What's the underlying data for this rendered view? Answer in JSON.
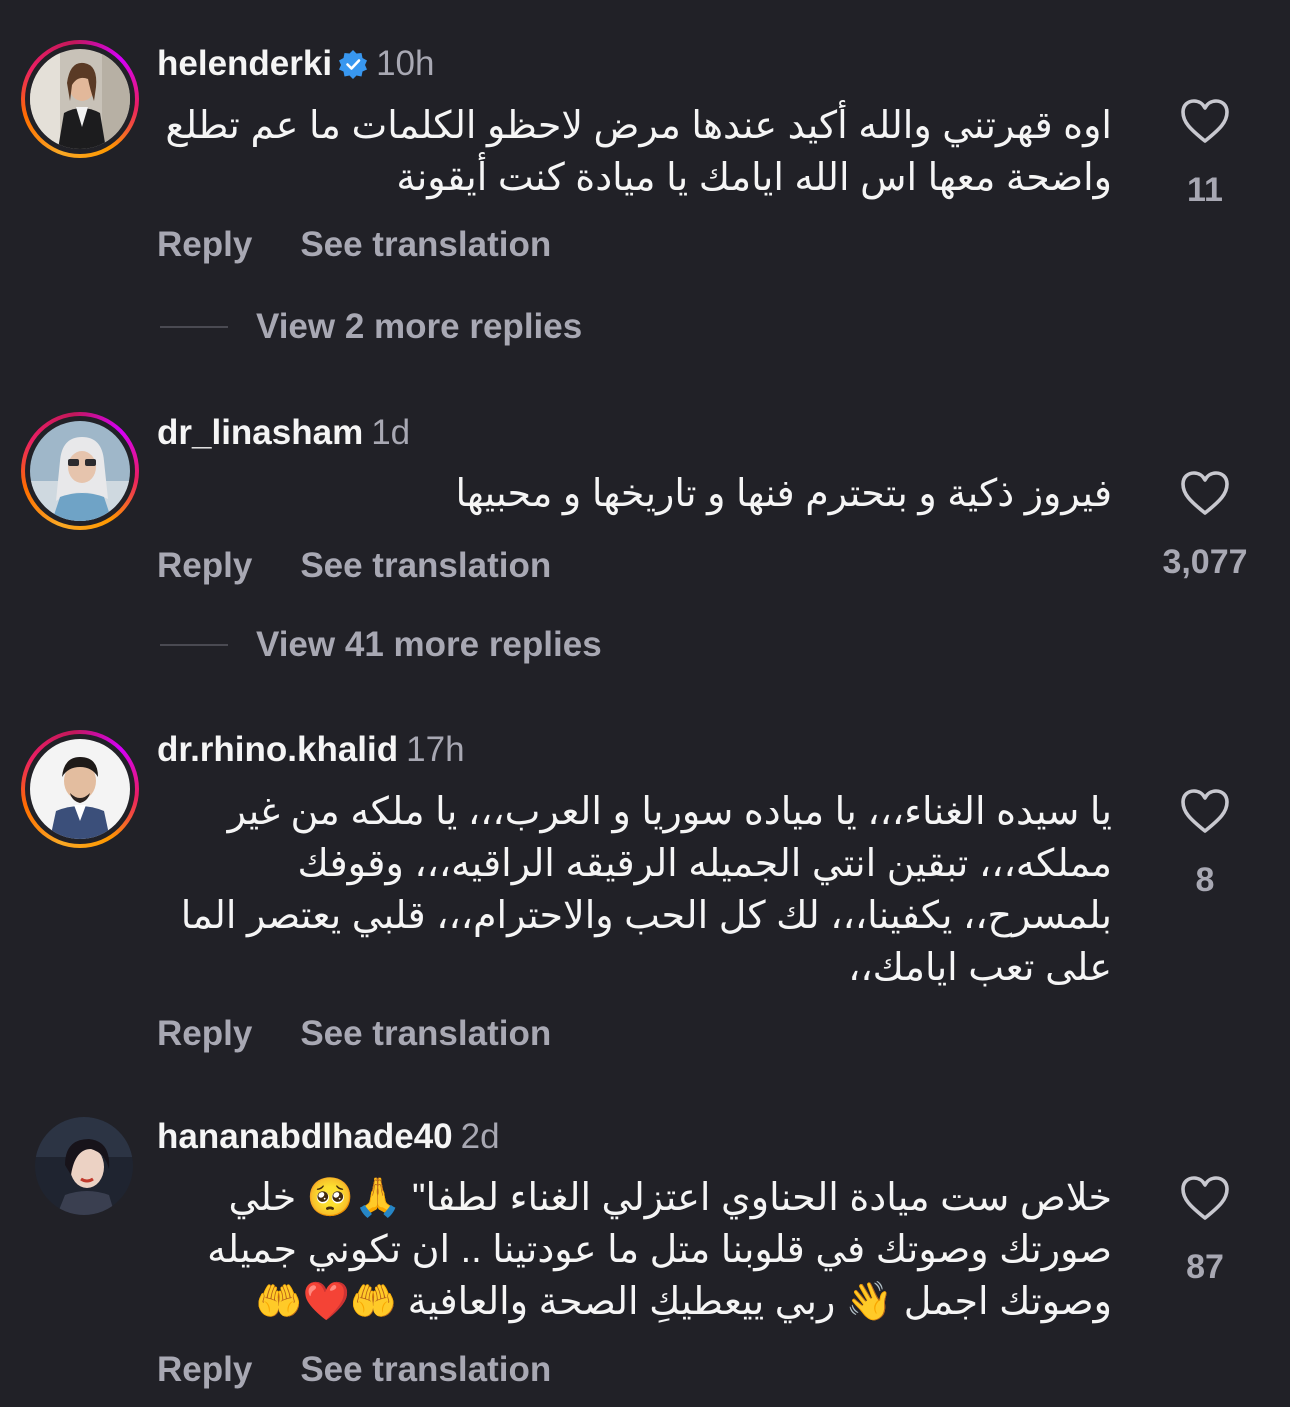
{
  "comments": [
    {
      "username": "helenderki",
      "verified": true,
      "time": "10h",
      "text": "اوه قهرتني والله أكيد عندها مرض لاحظو الكلمات ما عم تطلع واضحة معها  اس الله ايامك يا ميادة كنت أيقونة",
      "likes": "11",
      "reply_label": "Reply",
      "translate_label": "See translation",
      "view_replies": "View 2 more replies"
    },
    {
      "username": "dr_linasham",
      "verified": false,
      "time": "1d",
      "text": "فيروز ذكية و بتحترم فنها و تاريخها و محبيها",
      "likes": "3,077",
      "reply_label": "Reply",
      "translate_label": "See translation",
      "view_replies": "View 41 more replies"
    },
    {
      "username": "dr.rhino.khalid",
      "verified": false,
      "time": "17h",
      "text": "يا سيده الغناء،،، يا مياده سوريا و العرب،،، يا ملكه من غير مملكه،،، تبقين انتي الجميله الرقيقه الراقيه،،، وقوفك بلمسرح،، يكفينا،،، لك كل الحب والاحترام،،، قلبي يعتصر الما على تعب ايامك،،",
      "likes": "8",
      "reply_label": "Reply",
      "translate_label": "See translation"
    },
    {
      "username": "hananabdlhade40",
      "verified": false,
      "time": "2d",
      "text": "خلاص ست ميادة الحناوي اعتزلي الغناء لطفا\" 🙏🥺 خلي صورتك وصوتك في قلوبنا متل ما عودتينا .. ان تكوني جميله وصوتك اجمل 👋 ربي ييعطيكِ الصحة والعافية 🤲❤️🤲",
      "likes": "87",
      "reply_label": "Reply",
      "translate_label": "See translation"
    }
  ]
}
